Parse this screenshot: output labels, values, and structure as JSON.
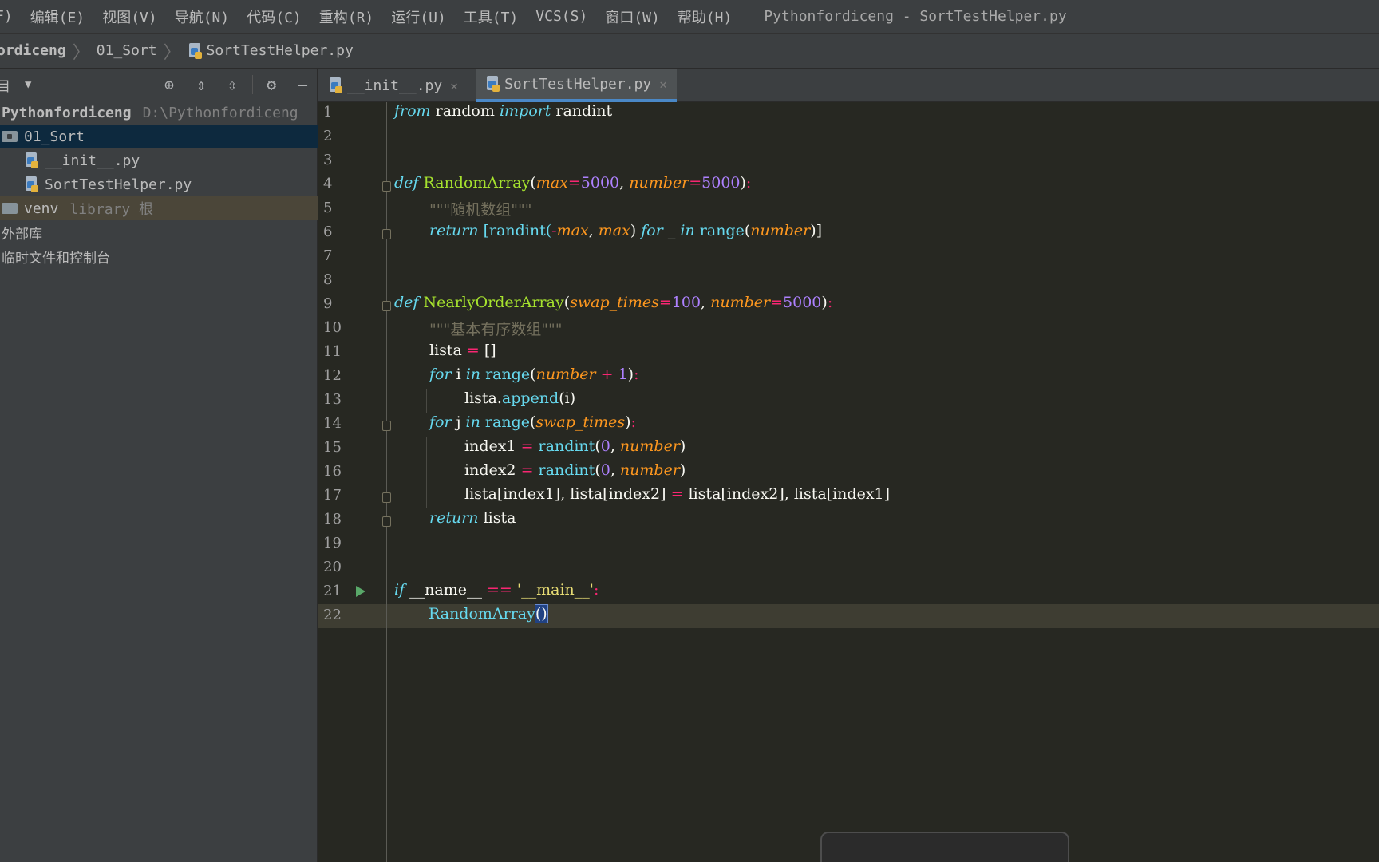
{
  "menubar": {
    "items": [
      "F)",
      "编辑(E)",
      "视图(V)",
      "导航(N)",
      "代码(C)",
      "重构(R)",
      "运行(U)",
      "工具(T)",
      "VCS(S)",
      "窗口(W)",
      "帮助(H)"
    ],
    "window_title": "Pythonfordiceng - SortTestHelper.py"
  },
  "breadcrumb": {
    "project": "ordiceng",
    "folder": "01_Sort",
    "file": "SortTestHelper.py"
  },
  "project_panel": {
    "label": "目",
    "tree": {
      "root_name": "Pythonfordiceng",
      "root_path": "D:\\Pythonfordiceng",
      "folder": "01_Sort",
      "file1": "__init__.py",
      "file2": "SortTestHelper.py",
      "venv": "venv",
      "venv_tag": "library 根",
      "external": "外部库",
      "scratches": "临时文件和控制台"
    }
  },
  "tabs": [
    {
      "label": "__init__.py",
      "active": false
    },
    {
      "label": "SortTestHelper.py",
      "active": true
    }
  ],
  "editor": {
    "line_numbers": [
      "1",
      "2",
      "3",
      "4",
      "5",
      "6",
      "7",
      "8",
      "9",
      "10",
      "11",
      "12",
      "13",
      "14",
      "15",
      "16",
      "17",
      "18",
      "19",
      "20",
      "21",
      "22"
    ],
    "current_line": "22",
    "code": {
      "l1": [
        "from",
        " random ",
        "import",
        " randint"
      ],
      "l4": [
        "def",
        " ",
        "RandomArray",
        "(",
        "max",
        "=",
        "5000",
        ", ",
        "number",
        "=",
        "5000",
        ")",
        ":"
      ],
      "l5": "\"\"\"随机数组\"\"\"",
      "l6": [
        "return",
        " [randint(",
        "-",
        "max",
        ", ",
        "max",
        ") ",
        "for",
        " _ ",
        "in",
        " ",
        "range",
        "(",
        "number",
        ")]"
      ],
      "l9": [
        "def",
        " ",
        "NearlyOrderArray",
        "(",
        "swap_times",
        "=",
        "100",
        ", ",
        "number",
        "=",
        "5000",
        ")",
        ":"
      ],
      "l10": "\"\"\"基本有序数组\"\"\"",
      "l11": [
        "lista ",
        "=",
        " []"
      ],
      "l12": [
        "for",
        " i ",
        "in",
        " ",
        "range",
        "(",
        "number",
        " + ",
        "1",
        ")",
        ":"
      ],
      "l13": [
        "lista.",
        "append",
        "(i)"
      ],
      "l14": [
        "for",
        " j ",
        "in",
        " ",
        "range",
        "(",
        "swap_times",
        ")",
        ":"
      ],
      "l15": [
        "index1 ",
        "=",
        " ",
        "randint",
        "(",
        "0",
        ", ",
        "number",
        ")"
      ],
      "l16": [
        "index2 ",
        "=",
        " ",
        "randint",
        "(",
        "0",
        ", ",
        "number",
        ")"
      ],
      "l17": [
        "lista[index1], lista[index2] ",
        "=",
        " lista[index2], lista[index1]"
      ],
      "l18": [
        "return",
        " lista"
      ],
      "l21": [
        "if",
        " __name__ ",
        "==",
        " ",
        "'__main__'",
        ":"
      ],
      "l22": [
        "RandomArray",
        "(",
        ")"
      ]
    }
  },
  "colors": {
    "background": "#272822",
    "keyword": "#66d9ef",
    "function": "#a6e22e",
    "parameter": "#fd971f",
    "number": "#ae81ff",
    "operator": "#f92672",
    "string": "#e6db74",
    "docstring": "#75715e",
    "selection": "#0d293e",
    "tab_underline": "#4a88c7"
  },
  "icons": [
    "python-file-icon",
    "folder-icon",
    "locate-icon",
    "expand-all-icon",
    "collapse-all-icon",
    "gear-icon",
    "minimize-icon",
    "run-arrow-icon",
    "fold-icon",
    "close-icon"
  ]
}
